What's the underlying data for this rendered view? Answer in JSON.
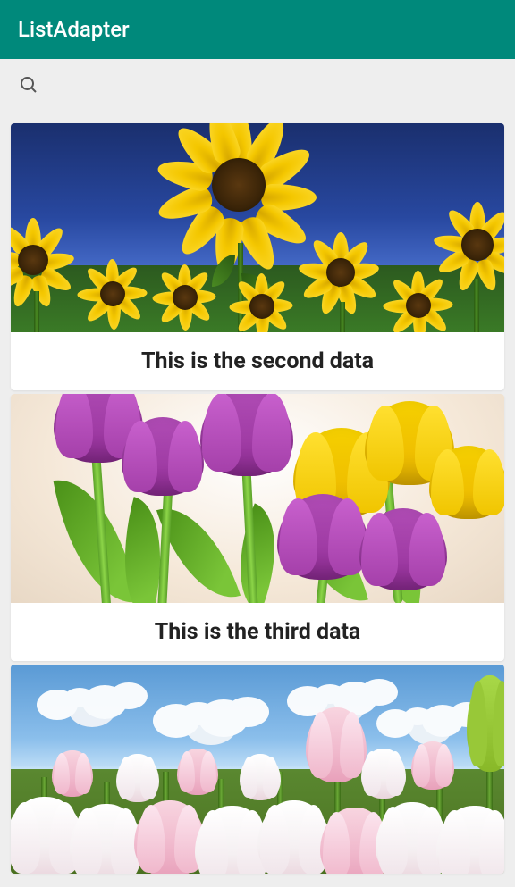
{
  "app_bar": {
    "title": "ListAdapter"
  },
  "toolbar": {
    "search_icon": "search"
  },
  "list": {
    "items": [
      {
        "label": "This is the second data",
        "image": "sunflowers"
      },
      {
        "label": "This is the third data",
        "image": "tulips"
      },
      {
        "label": "",
        "image": "tulip_field"
      }
    ]
  },
  "colors": {
    "primary": "#00897B",
    "background": "#eeeeee",
    "card_bg": "#ffffff",
    "text": "#222222"
  }
}
